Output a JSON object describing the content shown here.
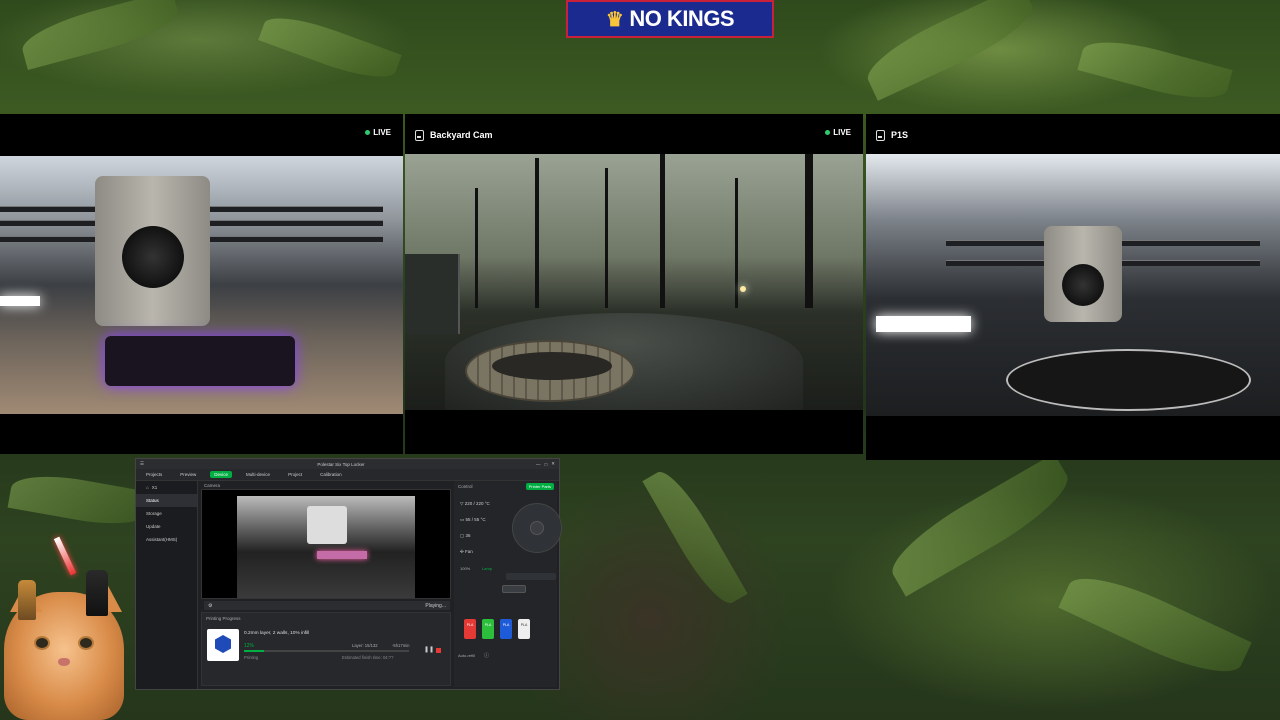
{
  "overlay": {
    "logo_text": "NO KINGS",
    "logo_icon": "crown-icon"
  },
  "cameras": [
    {
      "id": "left",
      "title": "",
      "live_label": "LIVE",
      "icon": "printer-cam-icon"
    },
    {
      "id": "center",
      "title": "Backyard Cam",
      "live_label": "LIVE",
      "icon": "camera-icon"
    },
    {
      "id": "right",
      "title": "P1S",
      "live_label": "",
      "icon": "camera-icon"
    }
  ],
  "app": {
    "window_title": "Polestar Six Top Locker",
    "home_label": "X1",
    "tabs": [
      {
        "label": "Projects"
      },
      {
        "label": "Preview"
      },
      {
        "label": "Device"
      },
      {
        "label": "Multi-device"
      },
      {
        "label": "Project"
      },
      {
        "label": "Calibration"
      }
    ],
    "sidebar": [
      {
        "label": "Status"
      },
      {
        "label": "Storage"
      },
      {
        "label": "Update"
      },
      {
        "label": "Assistant(HMS)"
      }
    ],
    "camera_label": "Camera",
    "camera_status": "Playing...",
    "control": {
      "header": "Control",
      "printer_parts_button": "Printer Parts",
      "nozzle_temp": "220 / 220 °C",
      "bed_temp": "55 / 55 °C",
      "chamber_temp": "36",
      "fan_label": "Fan",
      "speed_value": "100%",
      "lamp_label": "Lamp",
      "ams_slots": [
        {
          "label": "PLA",
          "color": "#e53935"
        },
        {
          "label": "PLA",
          "color": "#2bbf3c"
        },
        {
          "label": "PLA",
          "color": "#1e5bd8"
        },
        {
          "label": "PLA",
          "color": "#eeeeee"
        }
      ],
      "auto_refill": "Auto-refill"
    },
    "printing": {
      "header": "Printing Progress",
      "job_name": "0.2mm layer, 2 walls, 10% infill",
      "percent": "12%",
      "percent_value": 0.12,
      "layer": "Layer: 15/132",
      "time_left": "-5h17min",
      "stage": "Printing",
      "estimated": "Estimated finish time: 04:??"
    }
  }
}
